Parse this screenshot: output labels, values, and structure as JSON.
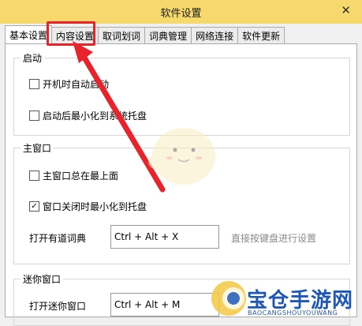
{
  "window": {
    "title": "软件设置",
    "close_glyph": "✕"
  },
  "tabs": [
    {
      "label": "基本设置",
      "active": true
    },
    {
      "label": "内容设置",
      "active": false
    },
    {
      "label": "取词划词",
      "active": false
    },
    {
      "label": "词典管理",
      "active": false
    },
    {
      "label": "网络连接",
      "active": false
    },
    {
      "label": "软件更新",
      "active": false
    }
  ],
  "startup": {
    "title": "启动",
    "options": [
      {
        "label": "开机时自动启动",
        "checked": false
      },
      {
        "label": "启动后最小化到系统托盘",
        "checked": false
      }
    ]
  },
  "main_window": {
    "title": "主窗口",
    "options": [
      {
        "label": "主窗口总在最上面",
        "checked": false
      },
      {
        "label": "窗口关闭时最小化到托盘",
        "checked": true
      }
    ],
    "hotkey_label": "打开有道词典",
    "hotkey_value": "Ctrl + Alt + X",
    "hint": "直接按键盘进行设置"
  },
  "mini_window": {
    "title": "迷你窗口",
    "hotkey_label": "打开迷你窗口",
    "hotkey_value": "Ctrl + Alt + M"
  },
  "watermark": {
    "text": "宝仓手游网",
    "sub": "BAOCANGSHOUYOUWANG"
  },
  "colors": {
    "titlebar": "#f6d86c",
    "highlight": "#e8232c",
    "watermark": "#1c58b8"
  }
}
